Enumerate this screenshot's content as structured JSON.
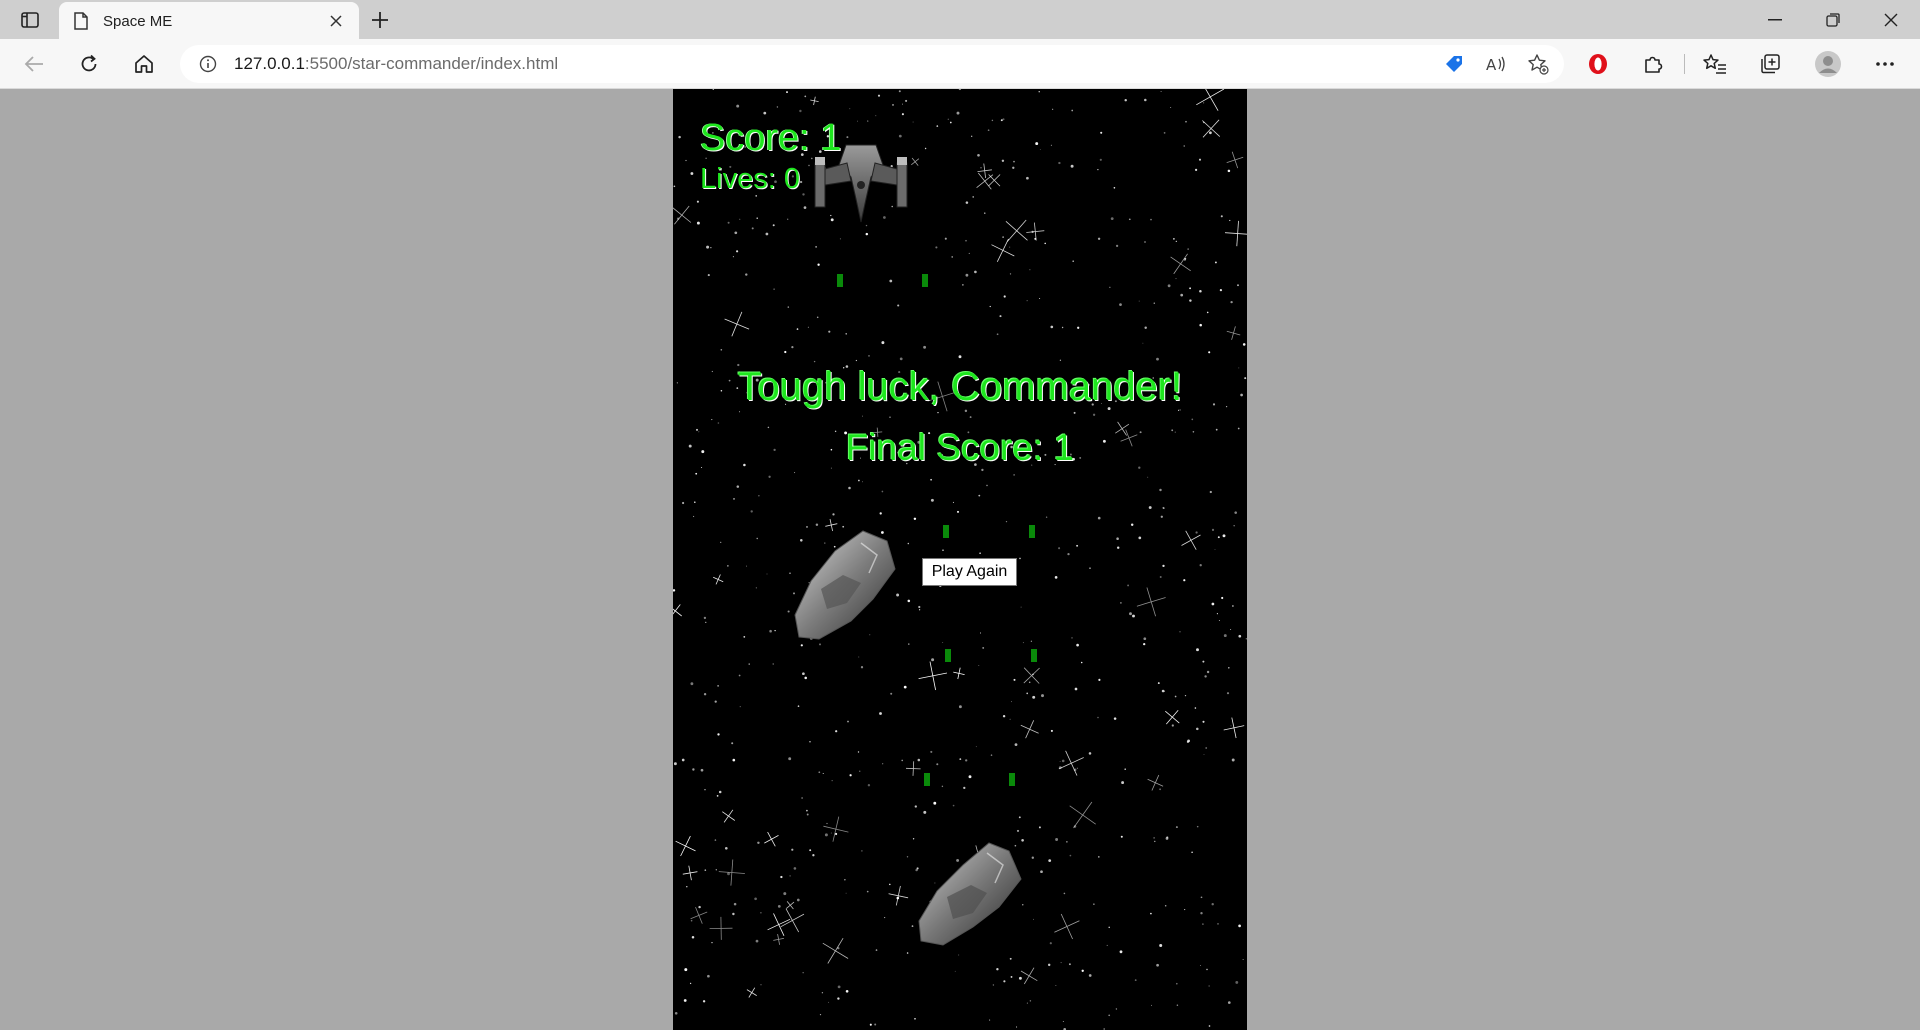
{
  "browser": {
    "tab_title": "Space ME",
    "url_host": "127.0.0.1",
    "url_rest": ":5500/star-commander/index.html"
  },
  "game": {
    "score_text": "Score: 1",
    "lives_text": "Lives: 0",
    "game_over_title": "Tough luck, Commander!",
    "final_score_text": "Final Score: 1",
    "play_again_label": "Play Again"
  },
  "colors": {
    "hud_green": "#1ee61e",
    "page_bg": "#a9a9a9",
    "game_bg": "#000000"
  },
  "icons": [
    "tab-actions-icon",
    "page-icon",
    "close-icon",
    "plus-icon",
    "minimize-icon",
    "restore-icon",
    "window-close-icon",
    "back-icon",
    "refresh-icon",
    "home-icon",
    "info-icon",
    "shopping-tag-icon",
    "read-aloud-icon",
    "add-favorite-icon",
    "opera-extension-icon",
    "extensions-icon",
    "favorites-icon",
    "collections-icon",
    "profile-icon",
    "more-icon"
  ]
}
